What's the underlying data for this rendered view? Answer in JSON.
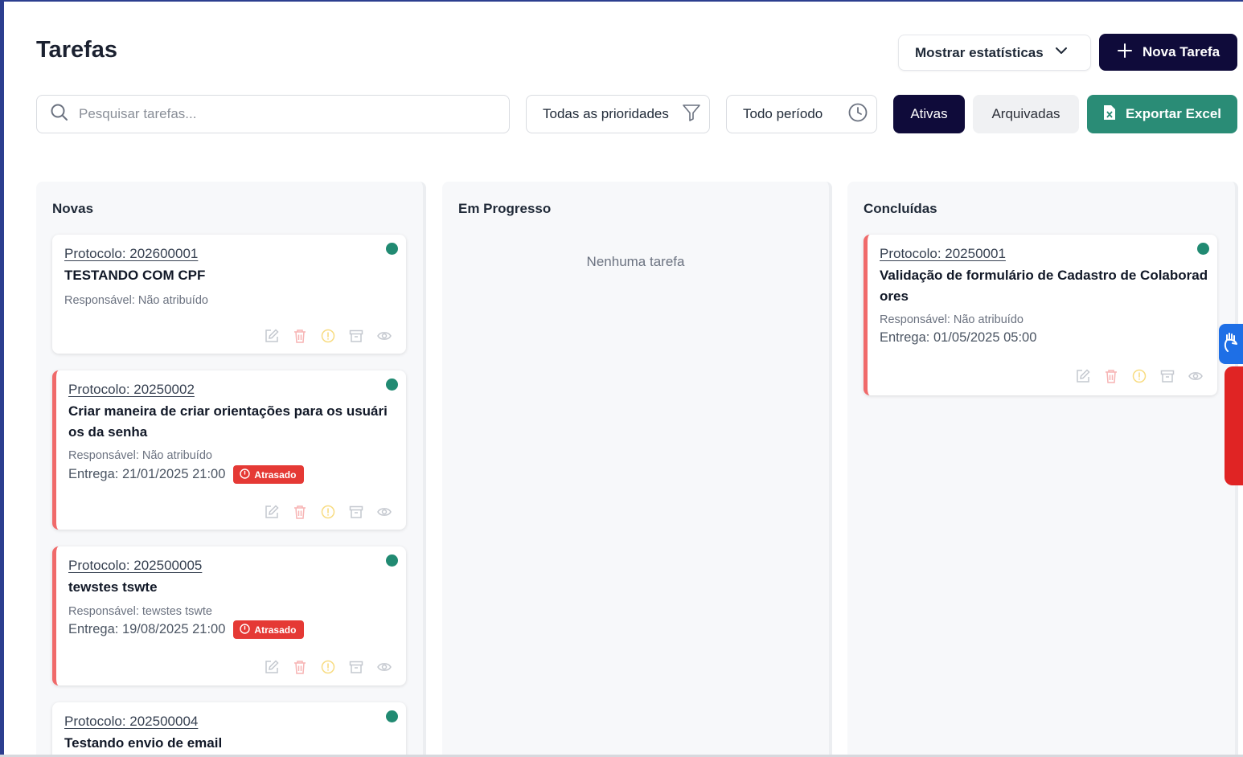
{
  "header": {
    "title": "Tarefas",
    "stats_label": "Mostrar estatísticas",
    "new_task_label": "Nova Tarefa"
  },
  "toolbar": {
    "search_placeholder": "Pesquisar tarefas...",
    "priority_filter": "Todas as prioridades",
    "period_filter": "Todo período",
    "active_label": "Ativas",
    "archived_label": "Arquivadas",
    "export_label": "Exportar Excel"
  },
  "columns": {
    "novas": {
      "title": "Novas",
      "cards": [
        {
          "protocol": "Protocolo: 202600001",
          "title": "TESTANDO COM CPF",
          "responsible": "Responsável: Não atribuído"
        },
        {
          "protocol": "Protocolo: 20250002",
          "title": "Criar maneira de criar orientações para os usuários da senha",
          "responsible": "Responsável: Não atribuído",
          "due": "Entrega: 21/01/2025 21:00",
          "badge": "Atrasado"
        },
        {
          "protocol": "Protocolo: 202500005",
          "title": "tewstes tswte",
          "responsible": "Responsável: tewstes tswte",
          "due": "Entrega: 19/08/2025 21:00",
          "badge": "Atrasado"
        },
        {
          "protocol": "Protocolo: 202500004",
          "title": "Testando envio de email"
        }
      ]
    },
    "em_progresso": {
      "title": "Em Progresso",
      "empty_message": "Nenhuma tarefa"
    },
    "concluidas": {
      "title": "Concluídas",
      "cards": [
        {
          "protocol": "Protocolo: 20250001",
          "title": "Validação de formulário de Cadastro de Colaboradores",
          "responsible": "Responsável: Não atribuído",
          "due": "Entrega: 01/05/2025 05:00"
        }
      ]
    }
  },
  "colors": {
    "primary": "#0f0b3a",
    "export": "#2a8c76",
    "status_dot": "#218a72",
    "overdue": "#e53935",
    "overdue_border": "#f06a6a"
  },
  "icons": {
    "card_actions": [
      "edit-icon",
      "trash-icon",
      "alert-icon",
      "archive-icon",
      "eye-icon"
    ]
  }
}
